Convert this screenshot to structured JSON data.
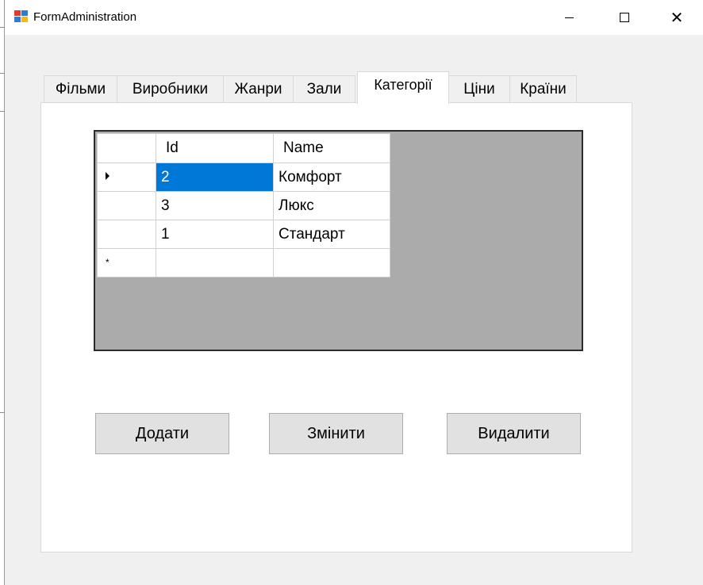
{
  "window": {
    "title": "FormAdministration",
    "icon": "winforms-app-icon",
    "controls": {
      "minimize": "minimize-icon",
      "maximize": "maximize-icon",
      "close": "close-icon"
    }
  },
  "tabs": [
    {
      "label": "Фільми",
      "active": false
    },
    {
      "label": "Виробники",
      "active": false
    },
    {
      "label": "Жанри",
      "active": false
    },
    {
      "label": "Зали",
      "active": false
    },
    {
      "label": "Категорії",
      "active": true
    },
    {
      "label": "Ціни",
      "active": false
    },
    {
      "label": "Країни",
      "active": false
    }
  ],
  "grid": {
    "columns": [
      "Id",
      "Name"
    ],
    "rows": [
      {
        "id": "2",
        "name": "Комфорт",
        "current": true,
        "id_selected": true
      },
      {
        "id": "3",
        "name": "Люкс"
      },
      {
        "id": "1",
        "name": "Стандарт"
      }
    ],
    "new_row_marker": "*",
    "selection_color": "#0078d7"
  },
  "buttons": {
    "add": "Додати",
    "edit": "Змінити",
    "delete": "Видалити"
  }
}
